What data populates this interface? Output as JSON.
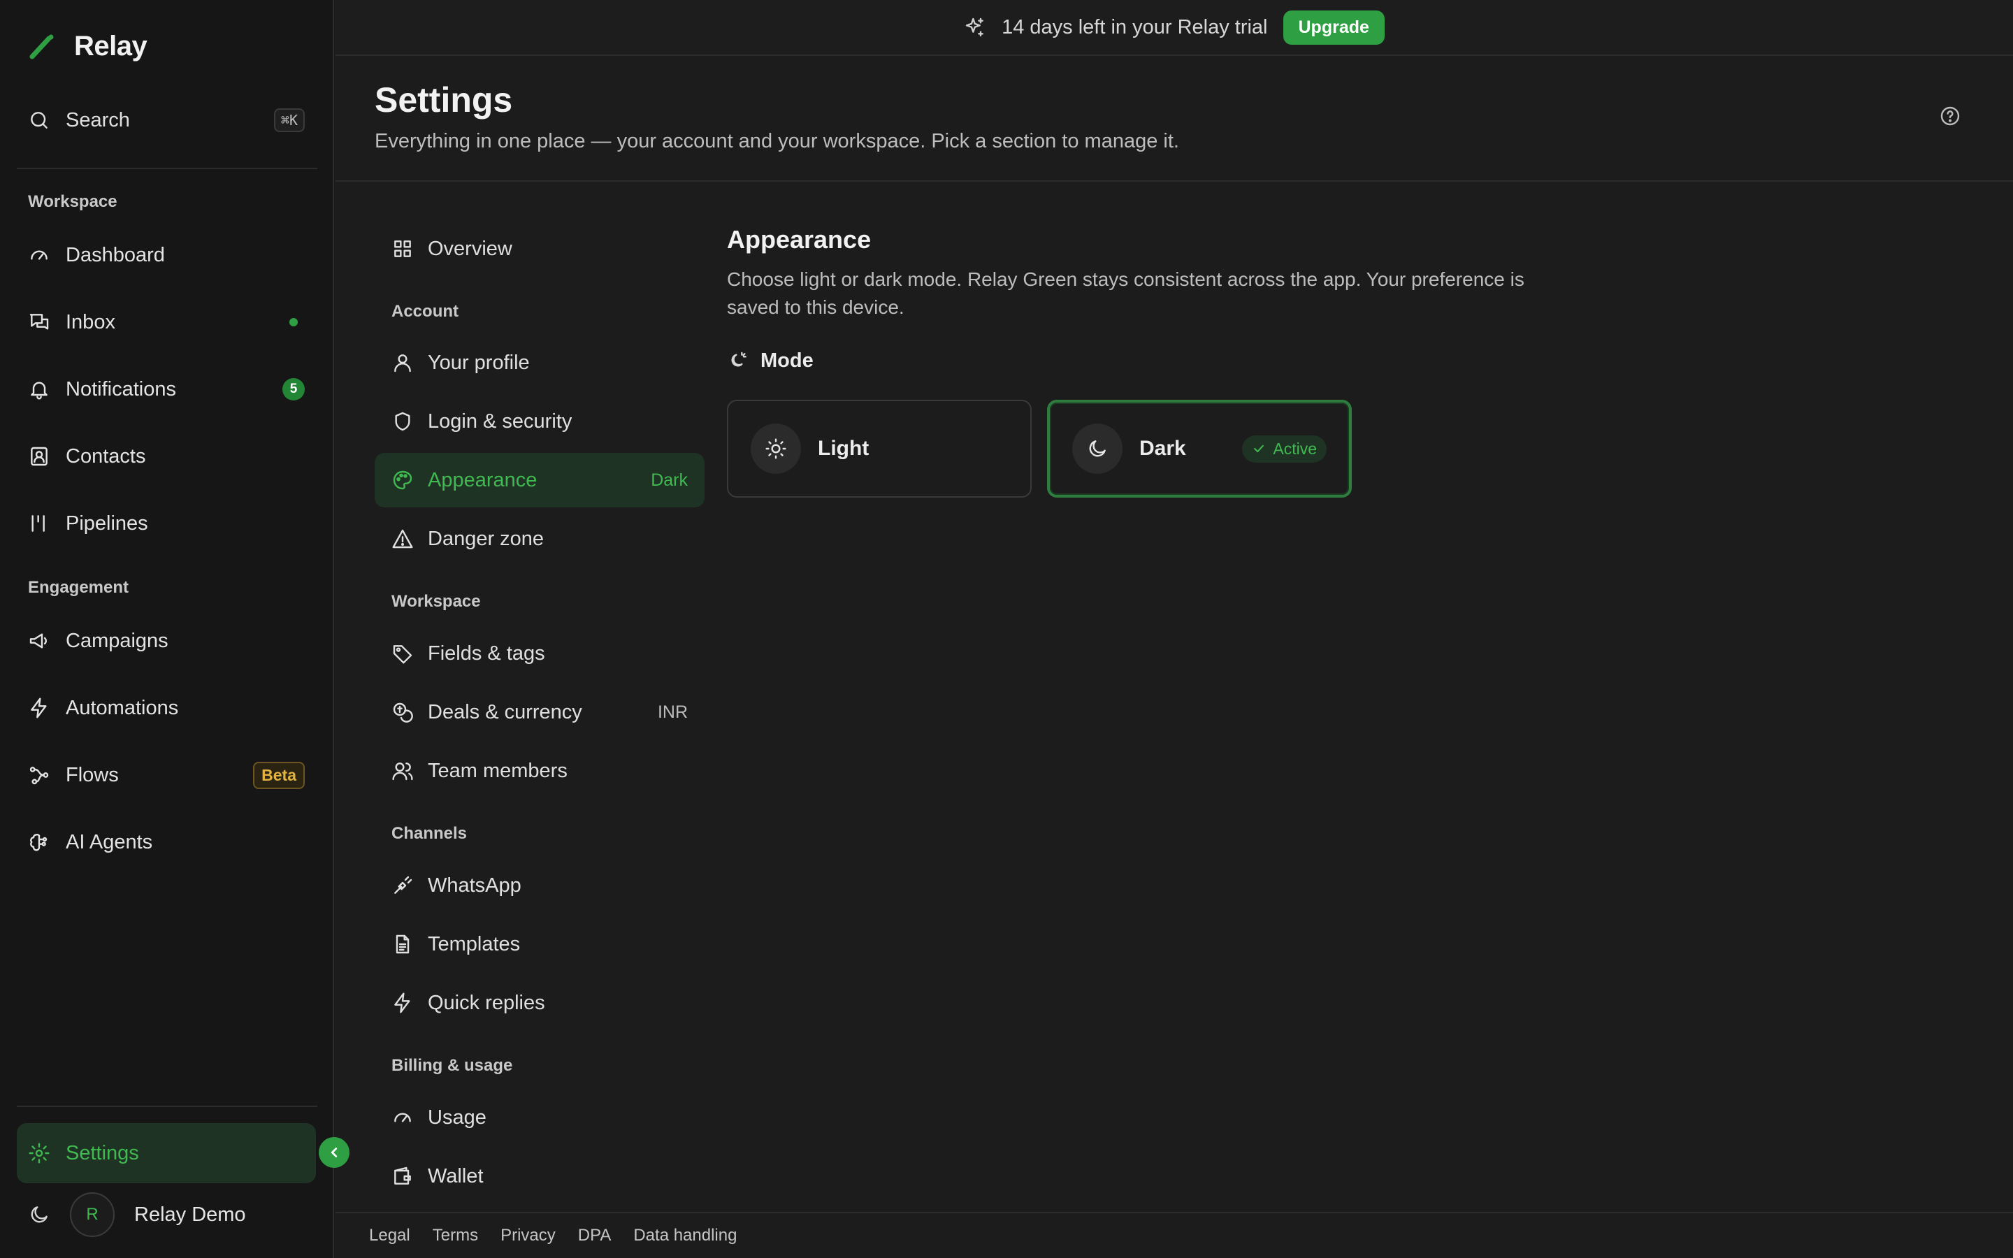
{
  "brand": {
    "name": "Relay"
  },
  "sidebar": {
    "search_label": "Search",
    "search_shortcut": "⌘K",
    "workspace_heading": "Workspace",
    "engagement_heading": "Engagement",
    "items": {
      "dashboard": "Dashboard",
      "inbox": "Inbox",
      "notifications": "Notifications",
      "notifications_count": "5",
      "contacts": "Contacts",
      "pipelines": "Pipelines",
      "campaigns": "Campaigns",
      "automations": "Automations",
      "flows": "Flows",
      "flows_badge": "Beta",
      "ai_agents": "AI Agents",
      "settings": "Settings"
    },
    "user": {
      "initial": "R",
      "name": "Relay Demo"
    }
  },
  "banner": {
    "text": "14 days left in your Relay trial",
    "button": "Upgrade"
  },
  "header": {
    "title": "Settings",
    "subtitle": "Everything in one place — your account and your workspace. Pick a section to manage it."
  },
  "settings_nav": {
    "overview": "Overview",
    "account_heading": "Account",
    "your_profile": "Your profile",
    "login_security": "Login & security",
    "appearance": "Appearance",
    "appearance_value": "Dark",
    "danger_zone": "Danger zone",
    "workspace_heading": "Workspace",
    "fields_tags": "Fields & tags",
    "deals_currency": "Deals & currency",
    "deals_currency_value": "INR",
    "team_members": "Team members",
    "channels_heading": "Channels",
    "whatsapp": "WhatsApp",
    "templates": "Templates",
    "quick_replies": "Quick replies",
    "billing_heading": "Billing & usage",
    "usage": "Usage",
    "wallet": "Wallet"
  },
  "content": {
    "title": "Appearance",
    "description": "Choose light or dark mode. Relay Green stays consistent across the app. Your preference is saved to this device.",
    "mode_label": "Mode",
    "options": {
      "light": "Light",
      "dark": "Dark"
    },
    "selected_option": "Dark",
    "active_label": "Active"
  },
  "footer": {
    "links": [
      "Legal",
      "Terms",
      "Privacy",
      "DPA",
      "Data handling"
    ]
  },
  "colors": {
    "accent": "#2ea043",
    "accent_text": "#3fb950",
    "background": "#1c1c1c",
    "sidebar": "#161616"
  }
}
